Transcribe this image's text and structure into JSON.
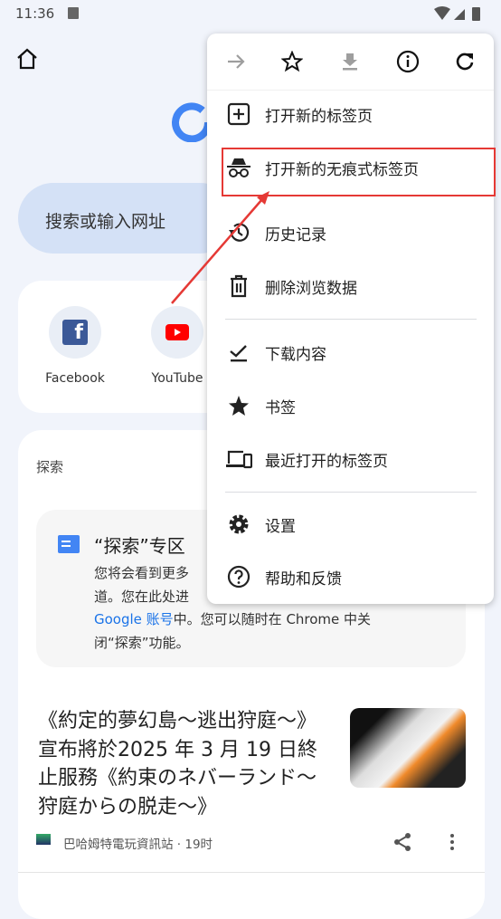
{
  "status_bar": {
    "time": "11:36"
  },
  "search": {
    "placeholder": "搜索或输入网址"
  },
  "shortcuts": [
    {
      "label": "Facebook"
    },
    {
      "label": "YouTube"
    }
  ],
  "discover": {
    "title": "探索",
    "promo": {
      "heading": "“探索”专区",
      "line1": "您将会看到更多",
      "line2": "道。您在此处进",
      "link": "Google 账号",
      "line3_rest": "中。您可以随时在 Chrome 中关",
      "line4": "闭“探索”功能。"
    },
    "article": {
      "title": "《約定的夢幻島～逃出狩庭～》宣布將於2025 年 3 月 19 日終止服務《約束のネバーランド～狩庭からの脱走～》",
      "source": "巴哈姆特電玩資訊站 · 19时"
    }
  },
  "menu": {
    "toolbar": [
      "forward-icon",
      "bookmark-star-icon",
      "download-icon",
      "info-icon",
      "refresh-icon"
    ],
    "items": [
      {
        "label": "打开新的标签页",
        "icon": "new-tab-icon"
      },
      {
        "label": "打开新的无痕式标签页",
        "icon": "incognito-icon",
        "highlighted": true
      },
      {
        "label": "历史记录",
        "icon": "history-icon"
      },
      {
        "label": "删除浏览数据",
        "icon": "trash-icon"
      },
      {
        "label": "下载内容",
        "icon": "downloads-check-icon"
      },
      {
        "label": "书签",
        "icon": "star-icon"
      },
      {
        "label": "最近打开的标签页",
        "icon": "devices-icon"
      },
      {
        "label": "设置",
        "icon": "gear-icon"
      },
      {
        "label": "帮助和反馈",
        "icon": "help-icon"
      }
    ]
  },
  "colors": {
    "highlight": "#e53935",
    "accent": "#1a73e8",
    "background": "#f1f4fb"
  }
}
